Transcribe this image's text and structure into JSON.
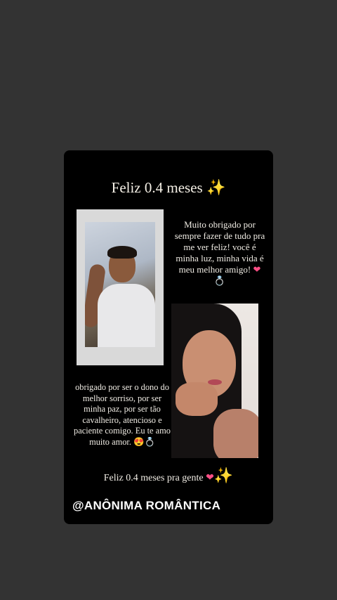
{
  "story": {
    "title": "Feliz 0.4 meses",
    "title_emoji": "✨",
    "message_right": "Muito obrigado por sempre fazer de tudo pra me ver feliz! você é minha luz, minha vida é meu melhor amigo!",
    "message_right_emojis": [
      "❤",
      "💍"
    ],
    "message_left": "obrigado por ser o dono do melhor sorriso, por ser minha paz, por ser tão cavalheiro, atencioso e paciente comigo. Eu te amo muito amor.",
    "message_left_emojis": [
      "😍",
      "💍"
    ],
    "footer": "Feliz 0.4 meses pra gente",
    "footer_emojis": [
      "❤",
      "✨"
    ],
    "handle": "@ANÔNIMA ROMÂNTICA"
  },
  "colors": {
    "page_background": "#333333",
    "card_background": "#000000",
    "text": "#f0ece4",
    "heart": "#ff4f86"
  },
  "icons": [
    "sparkles-icon",
    "heart-icon",
    "ring-icon",
    "heart-eyes-icon"
  ]
}
